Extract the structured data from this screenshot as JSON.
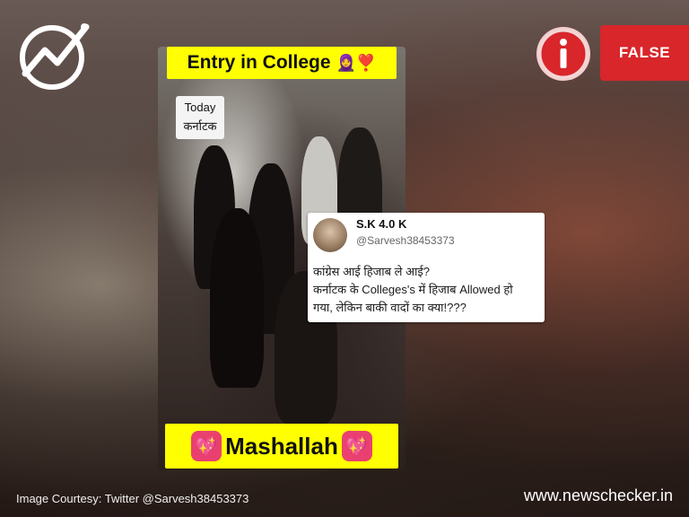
{
  "badge": {
    "label": "FALSE"
  },
  "video": {
    "top_banner": "Entry in College",
    "top_banner_emoji": "🧕❣️",
    "today_label_line1": "Today",
    "today_label_line2": "कर्नाटक",
    "bottom_banner": "Mashallah",
    "heart_emoji": "💖"
  },
  "tweet": {
    "name": "S.K 4.0 K",
    "handle": "@Sarvesh38453373",
    "text_line1": "कांग्रेस आई हिजाब ले आई?",
    "text_line2": "कर्नाटक के Colleges's में हिजाब Allowed हो",
    "text_line3": "गया, लेकिन बाकी वादों का क्या!???"
  },
  "footer": {
    "courtesy": "Image Courtesy: Twitter @Sarvesh38453373",
    "site": "www.newschecker.in"
  },
  "colors": {
    "brand_red": "#d8262b",
    "banner_yellow": "#ffff00"
  },
  "icons": {
    "logo": "newschecker-logo-icon",
    "info": "info-icon"
  }
}
